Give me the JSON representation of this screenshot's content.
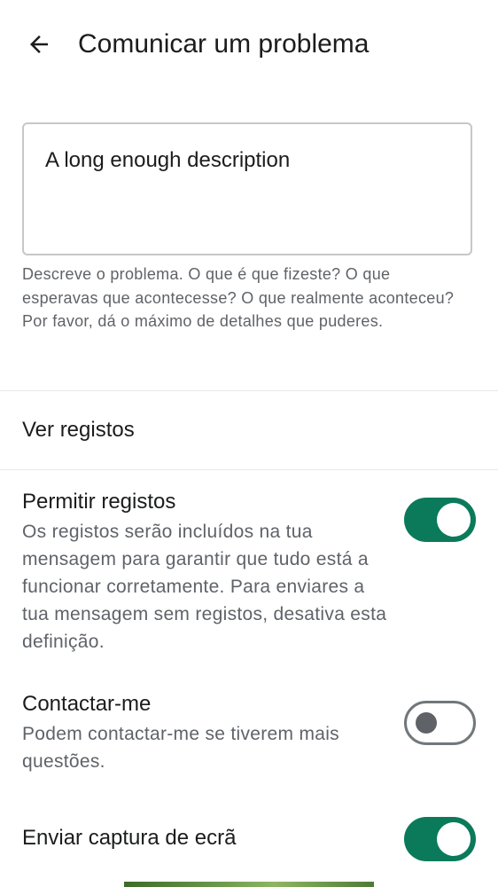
{
  "header": {
    "title": "Comunicar um problema",
    "back_icon": "arrow-left-icon"
  },
  "description": {
    "value": "A long enough description",
    "hint": "Descreve o problema. O que é que fizeste? O que esperavas que acontecesse? O que realmente aconteceu? Por favor, dá o máximo de detalhes que puderes."
  },
  "view_logs": {
    "label": "Ver registos"
  },
  "settings": [
    {
      "label": "Permitir registos",
      "description": "Os registos serão incluídos na tua mensagem para garantir que tudo está a funcionar corretamente. Para enviares a tua mensagem sem registos, desativa esta definição.",
      "enabled": true
    },
    {
      "label": "Contactar-me",
      "description": "Podem contactar-me se tiverem mais questões.",
      "enabled": false
    },
    {
      "label": "Enviar captura de ecrã",
      "enabled": true
    }
  ],
  "colors": {
    "accent": "#0b7a5b",
    "text_primary": "#1b1c1c",
    "text_secondary": "#5f6368",
    "switch_off_border": "#72777a"
  }
}
